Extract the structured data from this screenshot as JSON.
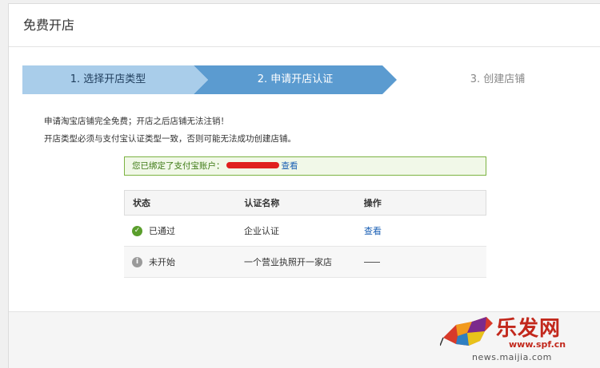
{
  "header": {
    "title": "免费开店"
  },
  "steps": [
    {
      "num": "1.",
      "label": "选择开店类型"
    },
    {
      "num": "2.",
      "label": "申请开店认证"
    },
    {
      "num": "3.",
      "label": "创建店铺"
    }
  ],
  "notes": [
    "申请淘宝店铺完全免费；开店之后店铺无法注销！",
    "开店类型必须与支付宝认证类型一致，否则可能无法成功创建店铺。"
  ],
  "notice": {
    "text": "您已绑定了支付宝账户：",
    "link": "查看"
  },
  "table": {
    "headers": [
      "状态",
      "认证名称",
      "操作"
    ],
    "rows": [
      {
        "status": "已通过",
        "status_icon": "check-circle-icon",
        "name": "企业认证",
        "action": "查看"
      },
      {
        "status": "未开始",
        "status_icon": "info-circle-icon",
        "name": "一个营业执照开一家店",
        "action": ""
      }
    ]
  },
  "watermark": {
    "title": "乐发网",
    "url": "www.spf.cn",
    "sub": "news.maijia.com"
  },
  "colors": {
    "active_step": "#5b9bd0",
    "done_step": "#a9cdea",
    "success": "#5a9e2c",
    "link": "#1a5fb4"
  }
}
